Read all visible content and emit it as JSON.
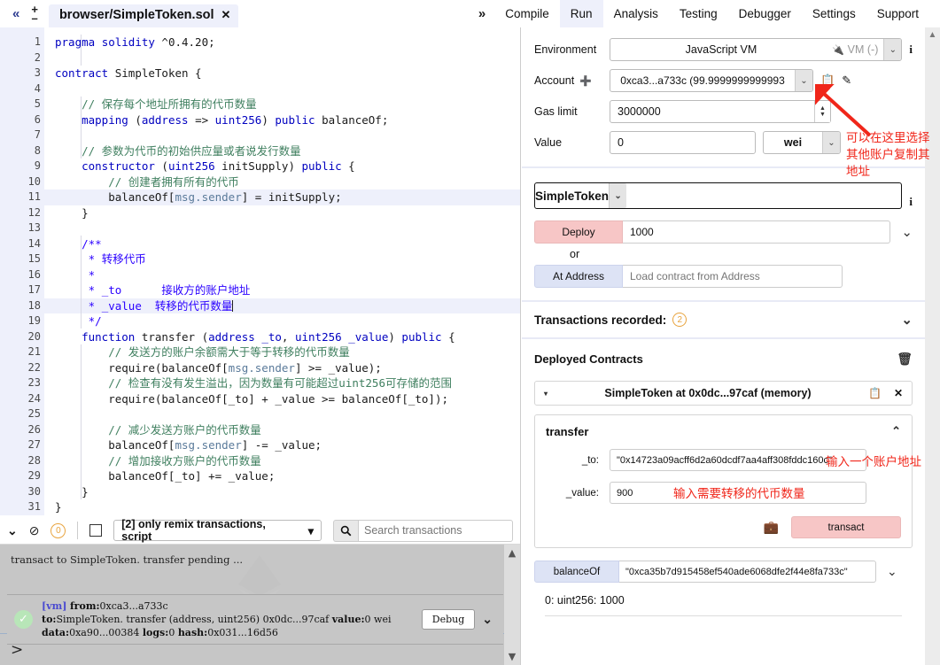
{
  "topbar": {
    "collapse_icon": "chevron-double-left",
    "plus_label": "+",
    "minus_label": "–",
    "file_tab": "browser/SimpleToken.sol",
    "file_tab_close": "✕",
    "expand_icon": "»",
    "tabs": [
      {
        "label": "Compile",
        "active": false
      },
      {
        "label": "Run",
        "active": true
      },
      {
        "label": "Analysis",
        "active": false
      },
      {
        "label": "Testing",
        "active": false
      },
      {
        "label": "Debugger",
        "active": false
      },
      {
        "label": "Settings",
        "active": false
      },
      {
        "label": "Support",
        "active": false
      }
    ]
  },
  "editor": {
    "lines": [
      {
        "n": "1",
        "fold": false,
        "hl": false
      },
      {
        "n": "2",
        "fold": false,
        "hl": false
      },
      {
        "n": "3",
        "fold": true,
        "hl": false
      },
      {
        "n": "4",
        "fold": false,
        "hl": false
      },
      {
        "n": "5",
        "fold": false,
        "hl": false
      },
      {
        "n": "6",
        "fold": false,
        "hl": false
      },
      {
        "n": "7",
        "fold": false,
        "hl": false
      },
      {
        "n": "8",
        "fold": false,
        "hl": false
      },
      {
        "n": "9",
        "fold": true,
        "hl": false
      },
      {
        "n": "10",
        "fold": false,
        "hl": false
      },
      {
        "n": "11",
        "fold": false,
        "hl": true
      },
      {
        "n": "12",
        "fold": false,
        "hl": false
      },
      {
        "n": "13",
        "fold": false,
        "hl": false
      },
      {
        "n": "14",
        "fold": true,
        "hl": false
      },
      {
        "n": "15",
        "fold": false,
        "hl": false
      },
      {
        "n": "16",
        "fold": false,
        "hl": false
      },
      {
        "n": "17",
        "fold": false,
        "hl": false
      },
      {
        "n": "18",
        "fold": false,
        "hl": true
      },
      {
        "n": "19",
        "fold": false,
        "hl": false
      },
      {
        "n": "20",
        "fold": true,
        "hl": false
      },
      {
        "n": "21",
        "fold": false,
        "hl": false
      },
      {
        "n": "22",
        "fold": false,
        "hl": false
      },
      {
        "n": "23",
        "fold": false,
        "hl": false
      },
      {
        "n": "24",
        "fold": false,
        "hl": false
      },
      {
        "n": "25",
        "fold": false,
        "hl": false
      },
      {
        "n": "26",
        "fold": false,
        "hl": false
      },
      {
        "n": "27",
        "fold": false,
        "hl": false
      },
      {
        "n": "28",
        "fold": false,
        "hl": false
      },
      {
        "n": "29",
        "fold": false,
        "hl": false
      },
      {
        "n": "30",
        "fold": false,
        "hl": false
      },
      {
        "n": "31",
        "fold": false,
        "hl": false
      }
    ],
    "source_text": [
      "pragma solidity ^0.4.20;",
      "",
      "contract SimpleToken {",
      "",
      "    // 保存每个地址所拥有的代币数量",
      "    mapping (address => uint256) public balanceOf;",
      "",
      "    // 参数为代币的初始供应量或者说发行数量",
      "    constructor (uint256 initSupply) public {",
      "        // 创建者拥有所有的代币",
      "        balanceOf[msg.sender] = initSupply;",
      "    }",
      "",
      "    /**",
      "     * 转移代币",
      "     *",
      "     * _to      接收方的账户地址",
      "     * _value  转移的代币数量",
      "     */",
      "    function transfer (address _to, uint256 _value) public {",
      "        // 发送方的账户余额需大于等于转移的代币数量",
      "        require(balanceOf[msg.sender] >= _value);",
      "        // 检查有没有发生溢出，因为数量有可能超过uint256可存储的范围",
      "        require(balanceOf[_to] + _value >= balanceOf[_to]);",
      "",
      "        // 减少发送方账户的代币数量",
      "        balanceOf[msg.sender] -= _value;",
      "        // 增加接收方账户的代币数量",
      "        balanceOf[_to] += _value;",
      "    }",
      "}"
    ]
  },
  "terminal": {
    "collapse_icon": "chevron-double-down",
    "clear_icon": "ban-circle",
    "pending_count": "0",
    "checkbox_checked": false,
    "filter_label": "[2] only remix transactions, script",
    "filter_caret": "▾",
    "search_icon": "search-icon",
    "search_placeholder": "Search transactions",
    "pending_line": "transact to SimpleToken. transfer pending ...",
    "log": {
      "status_icon": "check-circle",
      "vm_tag": "[vm]",
      "from_label": "from:",
      "from_value": "0xca3...a733c",
      "to_label": "to:",
      "to_value": "SimpleToken. transfer (address, uint256) 0x0dc...97caf",
      "value_label": "value:",
      "value_value": "0 wei",
      "data_label": "data:",
      "data_value": "0xa90...00384",
      "logs_label": "logs:",
      "logs_value": "0",
      "hash_label": "hash:",
      "hash_value": "0x031...16d56",
      "debug_button": "Debug",
      "expand_icon": "⌄"
    },
    "prompt": ">"
  },
  "run": {
    "environment": {
      "label": "Environment",
      "value": "JavaScript VM",
      "vm_tag": "VM (-)",
      "plug_icon": "plug-icon",
      "caret": "⌄",
      "info": "i"
    },
    "account": {
      "label": "Account",
      "plus_icon": "plus-circle-icon",
      "value": "0xca3...a733c (99.9999999999993",
      "caret": "⌄",
      "copy_icon": "copy-icon",
      "edit_icon": "edit-icon"
    },
    "gas_limit": {
      "label": "Gas limit",
      "value": "3000000"
    },
    "value_field": {
      "label": "Value",
      "value": "0",
      "unit": "wei",
      "caret": "⌄"
    },
    "contract_select": {
      "value": "SimpleToken",
      "caret": "⌄",
      "info": "i"
    },
    "deploy": {
      "button": "Deploy",
      "arg_value": "1000",
      "caret": "⌄"
    },
    "or_text": "or",
    "at_address": {
      "button": "At Address",
      "placeholder": "Load contract from Address"
    },
    "transactions_recorded": {
      "label": "Transactions recorded:",
      "count": "2",
      "caret": "⌄"
    },
    "deployed_contracts": {
      "label": "Deployed Contracts",
      "trash_icon": "trash-icon"
    },
    "instance": {
      "triangle": "▾",
      "name": "SimpleToken at 0x0dc...97caf (memory)",
      "copy_icon": "copy-icon",
      "close_icon": "✕"
    },
    "transfer_fn": {
      "title": "transfer",
      "collapse_caret": "⌃",
      "to_label": "_to:",
      "to_value": "\"0x14723a09acff6d2a60dcdf7aa4aff308fddc160c\"",
      "value_label": "_value:",
      "value_value": "900",
      "briefcase_icon": "briefcase-icon",
      "transact_button": "transact"
    },
    "balance_of": {
      "button": "balanceOf",
      "arg_value": "\"0xca35b7d915458ef540ade6068dfe2f44e8fa733c\"",
      "caret": "⌄",
      "result": "0: uint256: 1000"
    }
  },
  "annotations": [
    {
      "name": "account-dropdown-note",
      "text": "可以在这里选择\n其他账户复制其\n地址"
    },
    {
      "name": "to-field-note",
      "text": "输入一个账户地址"
    },
    {
      "name": "value-field-note",
      "text": "输入需要转移的代币数量"
    }
  ],
  "colors": {
    "accent_tab": "#eef0fb",
    "deploy_pink": "#f7c6c6",
    "at_address_blue": "#dde3f5",
    "annotation_red": "#f0261a",
    "badge_orange": "#e8a33d"
  }
}
